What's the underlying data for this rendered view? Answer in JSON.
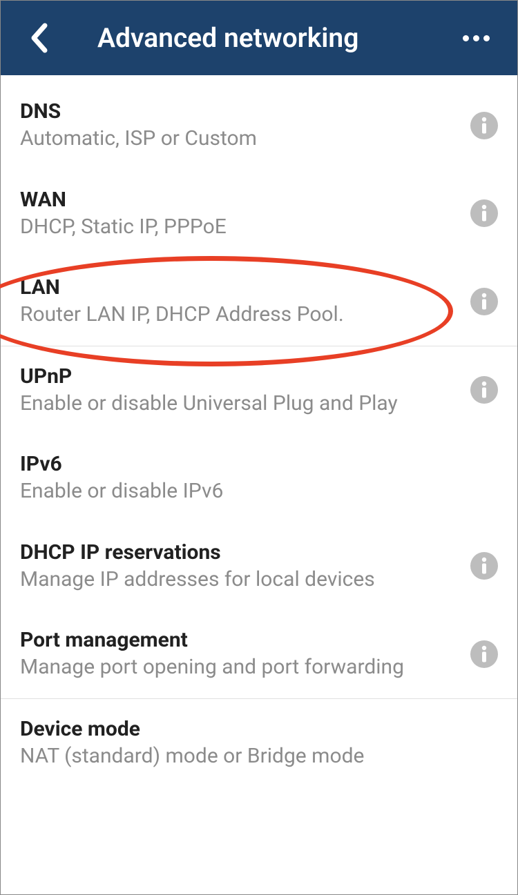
{
  "header": {
    "title": "Advanced networking"
  },
  "items": [
    {
      "title": "DNS",
      "subtitle": "Automatic, ISP or Custom",
      "info": true
    },
    {
      "title": "WAN",
      "subtitle": "DHCP, Static IP, PPPoE",
      "info": true
    },
    {
      "title": "LAN",
      "subtitle": "Router LAN IP, DHCP Address Pool.",
      "info": true
    },
    {
      "title": "UPnP",
      "subtitle": "Enable or disable Universal Plug and Play",
      "info": true
    },
    {
      "title": "IPv6",
      "subtitle": "Enable or disable IPv6",
      "info": false
    },
    {
      "title": "DHCP IP reservations",
      "subtitle": "Manage IP addresses for local devices",
      "info": true
    },
    {
      "title": "Port management",
      "subtitle": "Manage port opening and port forwarding",
      "info": true
    },
    {
      "title": "Device mode",
      "subtitle": "NAT (standard) mode or Bridge mode",
      "info": false
    }
  ]
}
